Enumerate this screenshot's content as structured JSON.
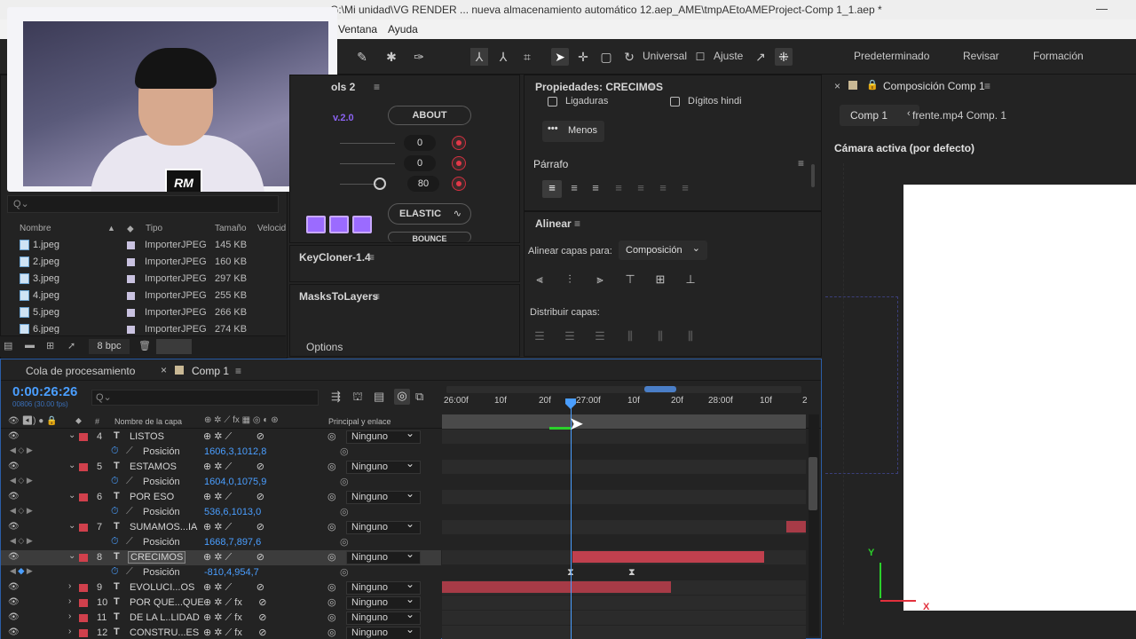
{
  "window": {
    "title_fragment": "G:\\Mi unidad\\VG RENDER ... nueva almacenamiento automático 12.aep_AME\\tmpAEtoAMEProject-Comp 1_1.aep *",
    "minimize_glyph": "—"
  },
  "menu": {
    "items": [
      "Ventana",
      "Ayuda"
    ]
  },
  "toolbar": {
    "universal": "Universal",
    "ajuste": "Ajuste",
    "workspaces": [
      "Predeterminado",
      "Revisar",
      "Formación"
    ]
  },
  "webcam": {
    "logo_text": "RM"
  },
  "project": {
    "search_placeholder": "",
    "search_glyph": "Q⌄",
    "columns": [
      "Nombre",
      "Tipo",
      "Tamaño",
      "Velocid"
    ],
    "files": [
      {
        "name": "1.jpeg",
        "type": "ImporterJPEG",
        "size": "145 KB"
      },
      {
        "name": "2.jpeg",
        "type": "ImporterJPEG",
        "size": "160 KB"
      },
      {
        "name": "3.jpeg",
        "type": "ImporterJPEG",
        "size": "297 KB"
      },
      {
        "name": "4.jpeg",
        "type": "ImporterJPEG",
        "size": "255 KB"
      },
      {
        "name": "5.jpeg",
        "type": "ImporterJPEG",
        "size": "266 KB"
      },
      {
        "name": "6.jpeg",
        "type": "ImporterJPEG",
        "size": "274 KB"
      }
    ],
    "bpc": "8 bpc"
  },
  "motion_tools": {
    "title_fragment": "ols 2",
    "version": "v.2.0",
    "about": "ABOUT",
    "values": [
      "0",
      "0",
      "80"
    ],
    "elastic": "ELASTIC",
    "bounce_fragment": "BOUNCE"
  },
  "keycloner": {
    "title": "KeyCloner-1.4"
  },
  "maskstolayers": {
    "title": "MasksToLayers",
    "options": "Options"
  },
  "properties": {
    "title": "Propiedades: CRECIMOS",
    "ligaduras": "Ligaduras",
    "digitos": "Dígitos hindi",
    "menos": "Menos",
    "parrafo": "Párrafo"
  },
  "alinear": {
    "title": "Alinear",
    "alinear_capas_para": "Alinear capas para:",
    "composicion": "Composición",
    "distribuir_capas": "Distribuir capas:"
  },
  "composition": {
    "title": "Composición Comp 1",
    "tab_active": "Comp 1",
    "breadcrumb": "frente.mp4 Comp. 1",
    "camera": "Cámara activa (por defecto)",
    "axis_y": "Y",
    "axis_x": "X"
  },
  "timeline": {
    "tab_queue": "Cola de procesamiento",
    "tab_comp": "Comp 1",
    "timecode": "0:00:26:26",
    "fps": "00806 (30.00 fps)",
    "col_layer_name": "Nombre de la capa",
    "col_parent": "Principal y enlace",
    "col_hash": "#",
    "ruler": [
      "26:00f",
      "10f",
      "20f",
      "27:00f",
      "10f",
      "20f",
      "28:00f",
      "10f",
      "2"
    ],
    "layers": [
      {
        "num": "4",
        "name": "LISTOS",
        "parent": "Ninguno",
        "color": "#d0404c",
        "pos": "1606,3,1012,8",
        "expanded": true
      },
      {
        "num": "5",
        "name": "ESTAMOS",
        "parent": "Ninguno",
        "color": "#d0404c",
        "pos": "1604,0,1075,9",
        "expanded": true
      },
      {
        "num": "6",
        "name": "POR ESO",
        "parent": "Ninguno",
        "color": "#d0404c",
        "pos": "536,6,1013,0",
        "expanded": true
      },
      {
        "num": "7",
        "name": "SUMAMOS...IA",
        "parent": "Ninguno",
        "color": "#d0404c",
        "pos": "1668,7,897,6",
        "expanded": true
      },
      {
        "num": "8",
        "name": "CRECIMOS",
        "parent": "Ninguno",
        "color": "#d0404c",
        "pos": "-810,4,954,7",
        "expanded": true,
        "selected": true
      },
      {
        "num": "9",
        "name": "EVOLUCI...OS",
        "parent": "Ninguno",
        "color": "#d0404c"
      },
      {
        "num": "10",
        "name": "POR QUE...QUE",
        "parent": "Ninguno",
        "color": "#d0404c",
        "fx": true
      },
      {
        "num": "11",
        "name": "DE LA L..LIDAD",
        "parent": "Ninguno",
        "color": "#d0404c",
        "fx": true
      },
      {
        "num": "12",
        "name": "CONSTRU...ES",
        "parent": "Ninguno",
        "color": "#d0404c",
        "fx": true
      }
    ],
    "position_label": "Posición"
  },
  "colors": {
    "accent_blue": "#4a9eff",
    "layer_red": "#a73b47",
    "purple": "#9b6bff"
  }
}
